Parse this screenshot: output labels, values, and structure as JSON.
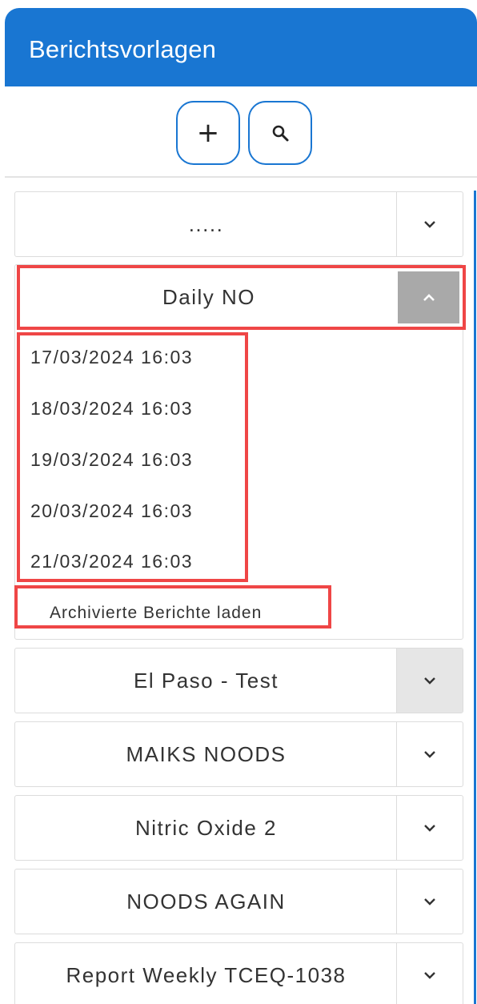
{
  "header": {
    "title": "Berichtsvorlagen"
  },
  "toolbar": {
    "add_label": "+",
    "add_icon": "plus-icon",
    "search_icon": "search-icon"
  },
  "colors": {
    "accent": "#1976d2",
    "highlight": "#ef4646",
    "toggle_open": "#a9a9a9",
    "toggle_hover": "#e6e6e6"
  },
  "templates": [
    {
      "label": ".....",
      "expanded": false
    },
    {
      "label": "Daily NO",
      "expanded": true,
      "reports": [
        "17/03/2024 16:03",
        "18/03/2024 16:03",
        "19/03/2024 16:03",
        "20/03/2024 16:03",
        "21/03/2024 16:03"
      ],
      "archive_label": "Archivierte Berichte laden"
    },
    {
      "label": "El Paso - Test",
      "expanded": false
    },
    {
      "label": "MAIKS NOODS",
      "expanded": false
    },
    {
      "label": "Nitric Oxide 2",
      "expanded": false
    },
    {
      "label": "NOODS AGAIN",
      "expanded": false
    },
    {
      "label": "Report Weekly TCEQ-1038",
      "expanded": false
    }
  ]
}
